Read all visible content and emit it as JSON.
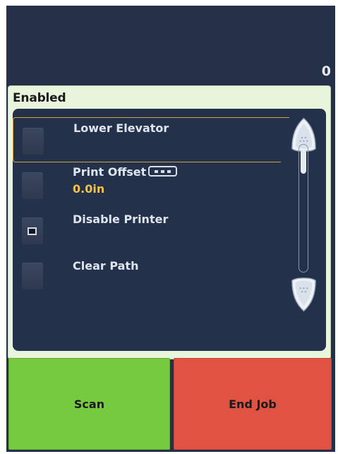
{
  "header": {
    "count": "0"
  },
  "panel": {
    "title": "Enabled"
  },
  "items": [
    {
      "label": "Lower Elevator",
      "checked": false,
      "selected": true
    },
    {
      "label": "Print Offset",
      "value": "0.0in",
      "checked": false,
      "has_more_button": true,
      "more_icon": "three-dots-button"
    },
    {
      "label": "Disable Printer",
      "checked": true
    },
    {
      "label": "Clear Path",
      "checked": false
    }
  ],
  "scroll": {
    "up_icon": "scroll-up-arrow",
    "down_icon": "scroll-down-arrow"
  },
  "buttons": {
    "scan": "Scan",
    "end_job": "End Job"
  },
  "colors": {
    "background": "#253148",
    "panel": "#e9f4dd",
    "list": "#24314a",
    "selected_border": "#d5a23c",
    "value_text": "#f0c24c",
    "scan_button": "#76ca3f",
    "end_job_button": "#e05242"
  }
}
